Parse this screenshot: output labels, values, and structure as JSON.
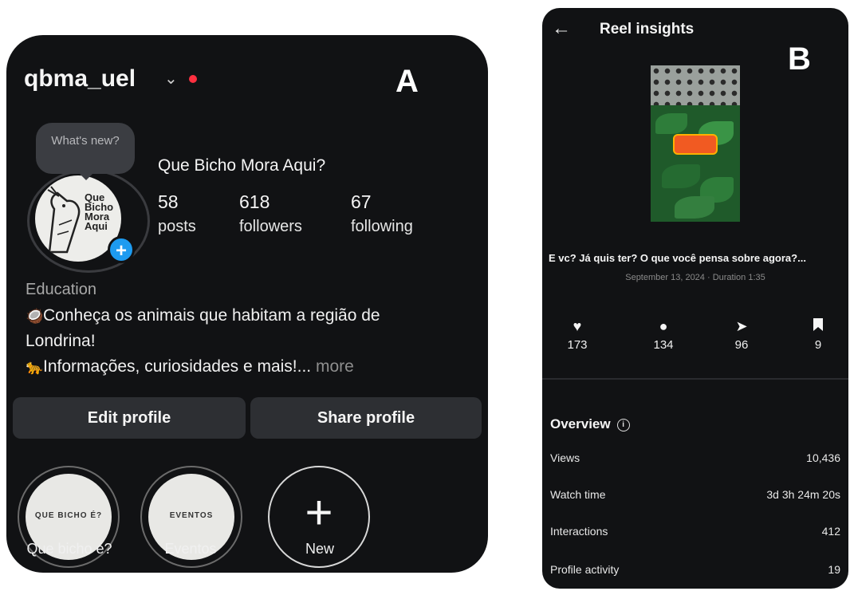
{
  "panel_a": {
    "letter": "A",
    "username": "qbma_uel",
    "whats_new": "What's new?",
    "avatar_text": "Que Bicho Mora Aqui",
    "display_name": "Que Bicho Mora Aqui?",
    "stats": [
      {
        "num": "58",
        "label": "posts"
      },
      {
        "num": "618",
        "label": "followers"
      },
      {
        "num": "67",
        "label": "following"
      }
    ],
    "category": "Education",
    "bio_line1": "Conheça os animais que habitam a região de",
    "bio_line2": "Londrina!",
    "bio_line3": "Informações, curiosidades e mais!...",
    "bio_more": " more",
    "edit_profile": "Edit profile",
    "share_profile": "Share profile",
    "highlights": [
      {
        "label": "Que bicho é?",
        "cover": "QUE BICHO É?"
      },
      {
        "label": "Eventos",
        "cover": "EVENTOS"
      },
      {
        "label": "New"
      }
    ]
  },
  "panel_b": {
    "letter": "B",
    "title": "Reel insights",
    "caption": "E vc? Já quis ter? O que você pensa sobre agora?...",
    "meta": "September 13, 2024 · Duration 1:35",
    "metrics": [
      {
        "icon": "heart-icon",
        "value": "173"
      },
      {
        "icon": "comment-icon",
        "value": "134"
      },
      {
        "icon": "share-icon",
        "value": "96"
      },
      {
        "icon": "bookmark-icon",
        "value": "9"
      }
    ],
    "overview_title": "Overview",
    "overview_rows": [
      {
        "label": "Views",
        "value": "10,436"
      },
      {
        "label": "Watch time",
        "value": "3d 3h 24m 20s"
      },
      {
        "label": "Interactions",
        "value": "412"
      },
      {
        "label": "Profile activity",
        "value": "19"
      }
    ]
  }
}
